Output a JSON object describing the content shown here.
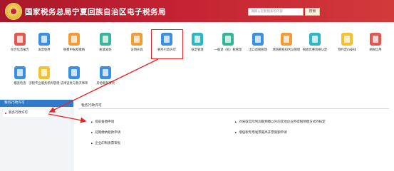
{
  "header": {
    "title": "国家税务总局宁夏回族自治区电子税务局",
    "search_placeholder": "请输入您要搜索的内容",
    "search_button": "搜索"
  },
  "tiles": [
    {
      "label": "综合信息报告",
      "color": "red"
    },
    {
      "label": "发票使用",
      "color": "blue"
    },
    {
      "label": "税费申报及缴纳",
      "color": "orange"
    },
    {
      "label": "税收减免",
      "color": "green"
    },
    {
      "label": "证明开具",
      "color": "orange"
    },
    {
      "label": "税务行政许可",
      "color": "blue"
    },
    {
      "label": "核定管理",
      "color": "teal"
    },
    {
      "label": "一般退（抵）税管理",
      "color": "green"
    },
    {
      "label": "出口退税管理",
      "color": "blue"
    },
    {
      "label": "增值税抵扣凭证管理",
      "color": "orange"
    },
    {
      "label": "税收优惠资格认定",
      "color": "teal"
    },
    {
      "label": "预约定价安排",
      "color": "yellow"
    },
    {
      "label": "纳税信用",
      "color": "red"
    },
    {
      "label": "稽查检查",
      "color": "blue"
    },
    {
      "label": "涉税专业服务机构管理",
      "color": "yellow"
    },
    {
      "label": "法律追责与救济事项",
      "color": "blue"
    },
    {
      "label": "其他服务事项",
      "color": "blue"
    }
  ],
  "left_panel": {
    "heading": "税务行政许可",
    "item": "税务行政许可"
  },
  "content": {
    "title": "税务行政许可",
    "links": [
      "提前备缴申请",
      "对采取实际利润额预缴以外的其他企业所得税预缴方式的核定",
      "延期缴纳税款申请",
      "增值税专用发票最高开票限额申请",
      "企业印制发票审批"
    ]
  }
}
